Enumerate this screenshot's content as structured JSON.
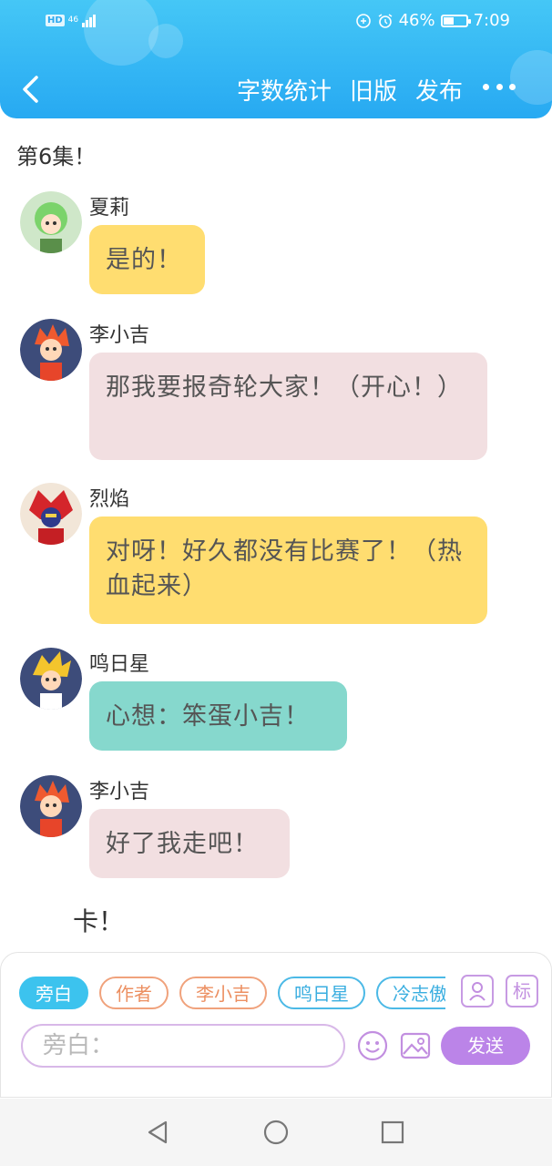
{
  "status_bar": {
    "hd": "HD",
    "network": "46",
    "battery_percent": "46%",
    "time": "7:09",
    "battery_level": 0.46
  },
  "header": {
    "back_icon": "chevron-left-icon",
    "actions": [
      "字数统计",
      "旧版",
      "发布"
    ],
    "more_icon": "more-dots-icon"
  },
  "chat": {
    "episode_title": "第6集！",
    "messages": [
      {
        "sender": "夏莉",
        "text": "是的！",
        "bubble": "yellow",
        "avatar_color": "#7bd36b"
      },
      {
        "sender": "李小吉",
        "text": "那我要报奇轮大家！（开心！）",
        "bubble": "pink",
        "avatar_color": "#ef5a2f"
      },
      {
        "sender": "烈焰",
        "text": "对呀！好久都没有比赛了！（热血起来）",
        "bubble": "yellow",
        "avatar_color": "#d4252b"
      },
      {
        "sender": "鸣日星",
        "text": "心想：笨蛋小吉！",
        "bubble": "teal",
        "avatar_color": "#f3c52d"
      },
      {
        "sender": "李小吉",
        "text": "好了我走吧！",
        "bubble": "pink",
        "avatar_color": "#ef5a2f"
      }
    ],
    "narration": "卡！"
  },
  "composer": {
    "roles": [
      "旁白",
      "作者",
      "李小吉",
      "鸣日星",
      "冷志傲"
    ],
    "active_role": "旁白",
    "role_icon": "user-card-icon",
    "tag_label": "标",
    "input_placeholder": "旁白：",
    "emoji_icon": "smiley-icon",
    "image_icon": "image-icon",
    "send_label": "发送"
  },
  "colors": {
    "header": "#2aa9f2",
    "send": "#bb84e8",
    "yellow_bubble": "#ffdd70",
    "pink_bubble": "#f2dfe1",
    "teal_bubble": "#86d8cd"
  },
  "system_nav": {
    "back": "triangle-back-icon",
    "home": "circle-home-icon",
    "recents": "square-recents-icon"
  }
}
